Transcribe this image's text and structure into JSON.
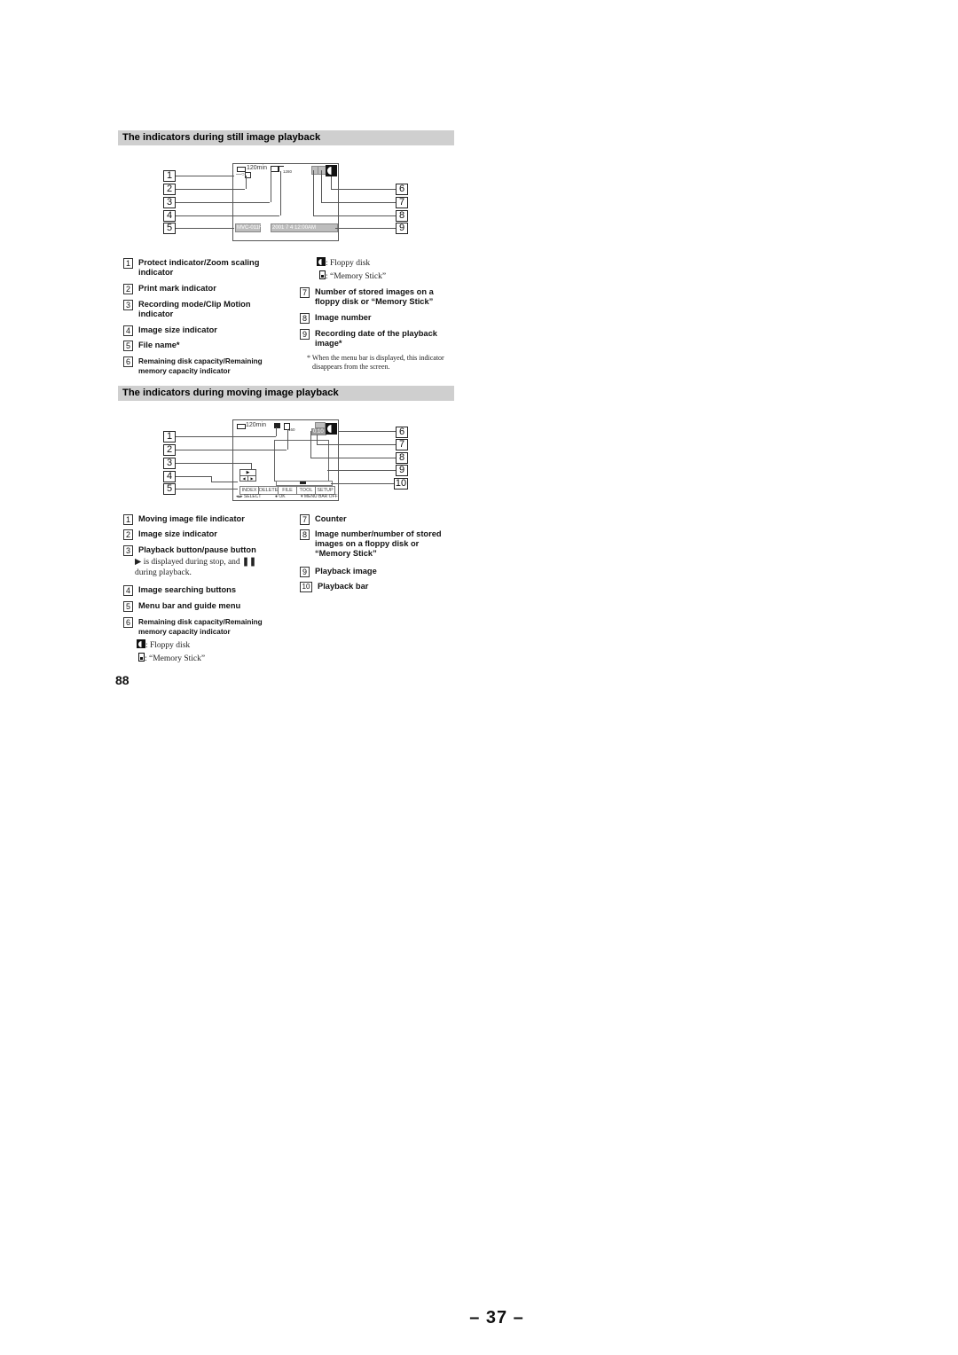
{
  "still_section": {
    "title": "The indicators during still image playback",
    "screen": {
      "battery_time": "120min",
      "file_name": "MVC-011F",
      "date": "2001   7   4  12:00AM",
      "image_size": "1280"
    },
    "callouts_left": [
      "1",
      "2",
      "3",
      "4",
      "5"
    ],
    "callouts_right": [
      "6",
      "7",
      "8",
      "9"
    ],
    "items_left": [
      {
        "num": "1",
        "label": "Protect indicator/Zoom scaling indicator"
      },
      {
        "num": "2",
        "label": "Print mark indicator"
      },
      {
        "num": "3",
        "label": "Recording mode/Clip Motion indicator"
      },
      {
        "num": "4",
        "label": "Image size indicator"
      },
      {
        "num": "5",
        "label": "File name*"
      },
      {
        "num": "6",
        "label": "Remaining disk capacity/Remaining memory capacity indicator"
      }
    ],
    "media_legend": [
      {
        "icon": "floppy-disk-icon",
        "label": ": Floppy disk"
      },
      {
        "icon": "memory-stick-icon",
        "label": ": “Memory Stick”"
      }
    ],
    "items_right": [
      {
        "num": "7",
        "label": "Number of stored images on a floppy disk or “Memory Stick”"
      },
      {
        "num": "8",
        "label": "Image number"
      },
      {
        "num": "9",
        "label": "Recording date of the playback image*"
      }
    ],
    "footnote": "* When the menu bar is displayed, this indicator disappears from the screen."
  },
  "moving_section": {
    "title": "The indicators during moving image playback",
    "screen": {
      "battery_time": "120min",
      "image_size": "160",
      "counter": "0:10",
      "menu": [
        "INDEX",
        "DELETE",
        "FILE",
        "TOOL",
        "SETUP"
      ],
      "guide": [
        "◂▴▸ SELECT",
        "● OK",
        "▾ MENU BAR OFF"
      ]
    },
    "callouts_left": [
      "1",
      "2",
      "3",
      "4",
      "5"
    ],
    "callouts_right": [
      "6",
      "7",
      "8",
      "9",
      "10"
    ],
    "items_left": [
      {
        "num": "1",
        "label": "Moving image file indicator"
      },
      {
        "num": "2",
        "label": "Image size indicator"
      },
      {
        "num": "3",
        "label": "Playback button/pause button"
      },
      {
        "num": "4",
        "label": "Image searching buttons"
      },
      {
        "num": "5",
        "label": "Menu bar and guide menu"
      },
      {
        "num": "6",
        "label": "Remaining disk capacity/Remaining memory capacity indicator"
      }
    ],
    "playback_note_1": " is displayed during stop, and ",
    "playback_note_2": "during playback.",
    "media_legend": [
      {
        "icon": "floppy-disk-icon",
        "label": ": Floppy disk"
      },
      {
        "icon": "memory-stick-icon",
        "label": ": “Memory Stick”"
      }
    ],
    "items_right": [
      {
        "num": "7",
        "label": "Counter"
      },
      {
        "num": "8",
        "label": "Image number/number of stored images on a floppy disk or “Memory Stick”"
      },
      {
        "num": "9",
        "label": "Playback image"
      },
      {
        "num": "10",
        "label": "Playback bar"
      }
    ]
  },
  "manual_page_number": "88",
  "service_page_number": "– 37 –"
}
